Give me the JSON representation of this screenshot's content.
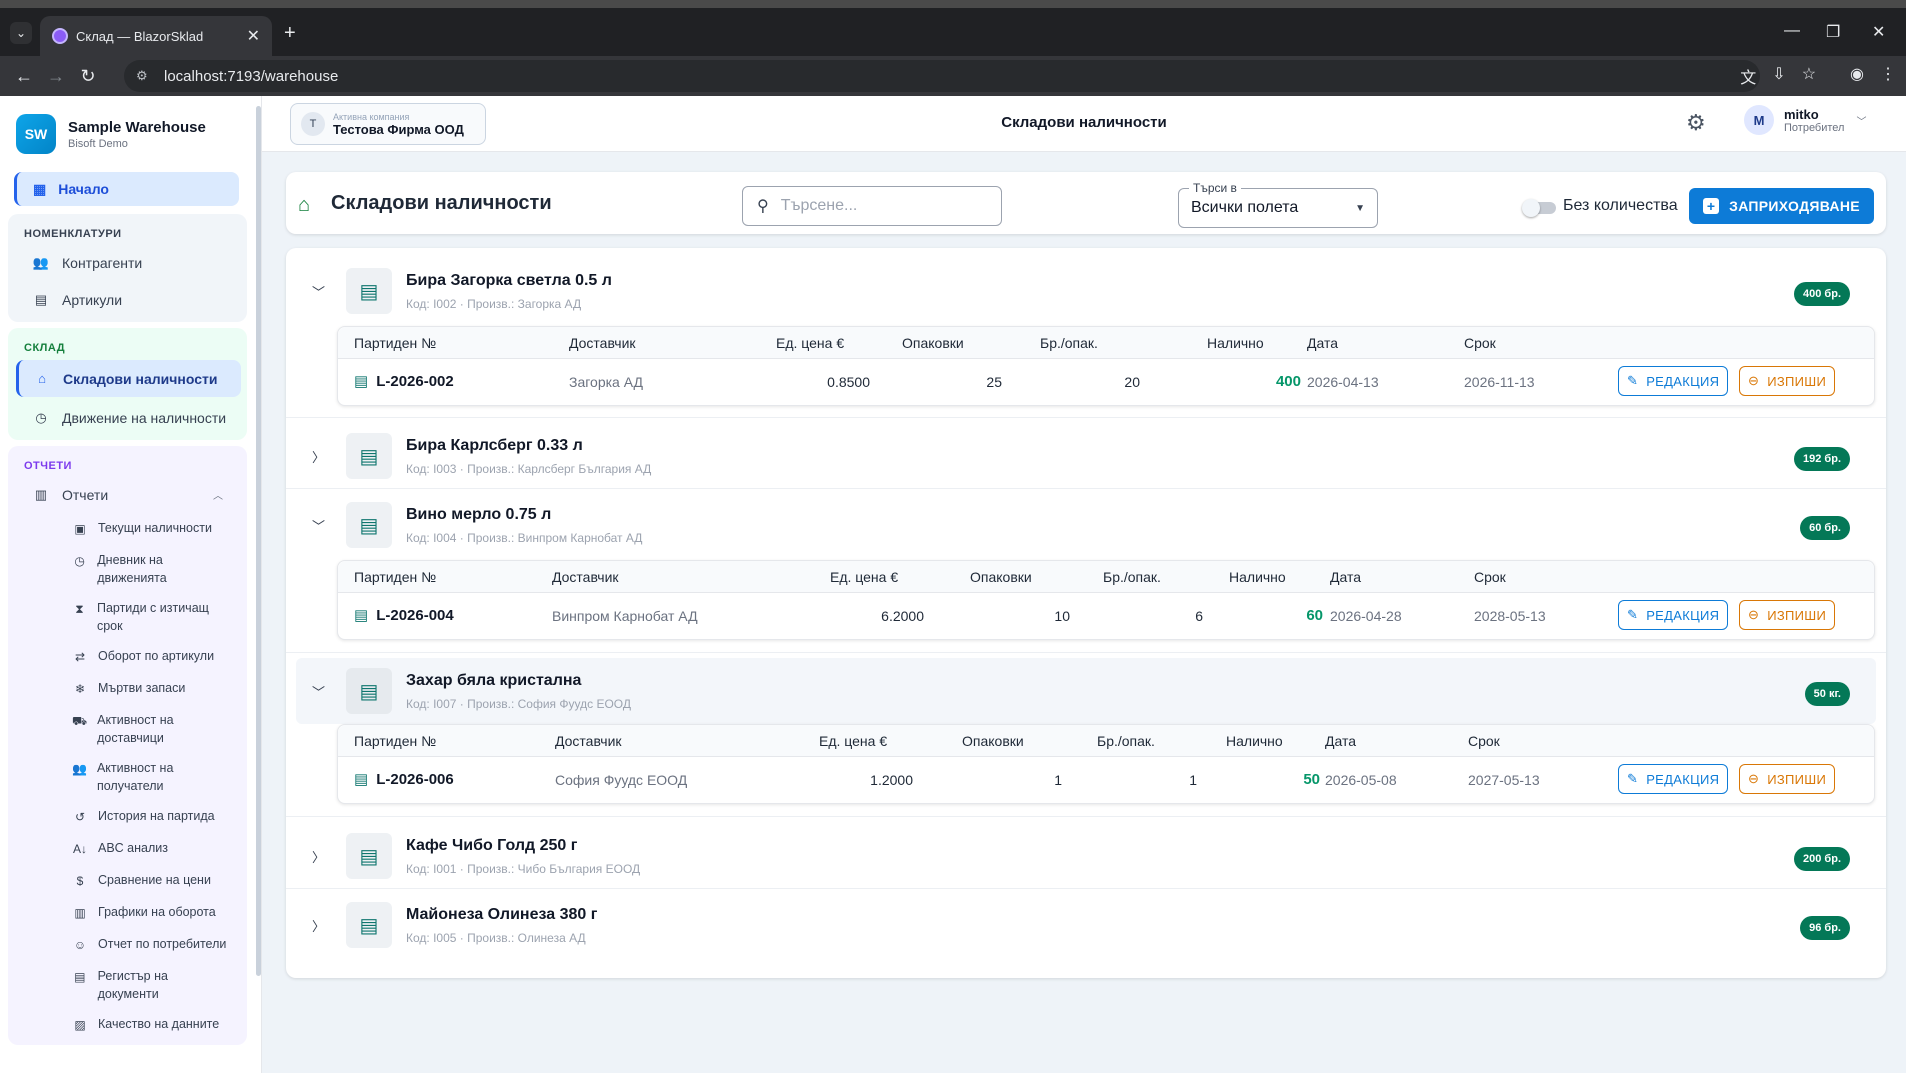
{
  "browser": {
    "tab_title": "Склад — BlazorSklad",
    "url": "localhost:7193/warehouse"
  },
  "sidebar": {
    "brand": {
      "initials": "SW",
      "name": "Sample Warehouse",
      "sub": "Bisoft Demo"
    },
    "home": "Начало",
    "groups": {
      "nom": {
        "title": "НОМЕНКЛАТУРИ",
        "items": [
          "Контрагенти",
          "Артикули"
        ]
      },
      "sklad": {
        "title": "СКЛАД",
        "items": [
          "Складови наличности",
          "Движение на наличности"
        ]
      },
      "reports": {
        "title": "ОТЧЕТИ",
        "parent": "Отчети",
        "items": [
          "Текущи наличности",
          "Дневник на движенията",
          "Партиди с изтичащ срок",
          "Оборот по артикули",
          "Мъртви запаси",
          "Активност на доставчици",
          "Активност на получатели",
          "История на партида",
          "ABC анализ",
          "Сравнение на цени",
          "Графики на оборота",
          "Отчет по потребители",
          "Регистър на документи",
          "Качество на данните"
        ]
      }
    }
  },
  "topbar": {
    "company_label": "Активна компания",
    "company_initial": "T",
    "company_name": "Тестова Фирма ООД",
    "page_title": "Складови наличности",
    "user_initial": "M",
    "user_name": "mitko",
    "user_role": "Потребител"
  },
  "toolbar": {
    "title": "Складови наличности",
    "search_placeholder": "Търсене...",
    "search_in_label": "Търси в",
    "search_in_value": "Всички полета",
    "toggle_label": "Без количества",
    "receive_button": "ЗАПРИХОДЯВАНЕ"
  },
  "batch_headers": {
    "lot": "Партиден №",
    "supplier": "Доставчик",
    "price": "Ед. цена €",
    "packs": "Опаковки",
    "per_pack": "Бр./опак.",
    "available": "Налично",
    "date": "Дата",
    "expiry": "Срок",
    "edit": "РЕДАКЦИЯ",
    "writeoff": "ИЗПИШИ"
  },
  "products": [
    {
      "name": "Бира Загорка светла 0.5 л",
      "meta": "Код: I002 · Произв.: Загорка АД",
      "badge": "400 бр.",
      "expanded": true,
      "batch": {
        "lot": "L-2026-002",
        "supplier": "Загорка АД",
        "price": "0.8500",
        "packs": "25",
        "per_pack": "20",
        "available": "400",
        "date": "2026-04-13",
        "expiry": "2026-11-13"
      }
    },
    {
      "name": "Бира Карлсберг 0.33 л",
      "meta": "Код: I003 · Произв.: Карлсберг България АД",
      "badge": "192 бр.",
      "expanded": false
    },
    {
      "name": "Вино мерло 0.75 л",
      "meta": "Код: I004 · Произв.: Винпром Карнобат АД",
      "badge": "60 бр.",
      "expanded": true,
      "batch": {
        "lot": "L-2026-004",
        "supplier": "Винпром Карнобат АД",
        "price": "6.2000",
        "packs": "10",
        "per_pack": "6",
        "available": "60",
        "date": "2026-04-28",
        "expiry": "2028-05-13"
      }
    },
    {
      "name": "Захар бяла кристална",
      "meta": "Код: I007 · Произв.: София Фуудс ЕООД",
      "badge": "50 кг.",
      "expanded": true,
      "batch": {
        "lot": "L-2026-006",
        "supplier": "София Фуудс ЕООД",
        "price": "1.2000",
        "packs": "1",
        "per_pack": "1",
        "available": "50",
        "date": "2026-05-08",
        "expiry": "2027-05-13"
      }
    },
    {
      "name": "Кафе Чибо Голд 250 г",
      "meta": "Код: I001 · Произв.: Чибо България ЕООД",
      "badge": "200 бр.",
      "expanded": false
    },
    {
      "name": "Майонеза Олинеза 380 г",
      "meta": "Код: I005 · Произв.: Олинеза АД",
      "badge": "96 бр.",
      "expanded": false
    }
  ]
}
